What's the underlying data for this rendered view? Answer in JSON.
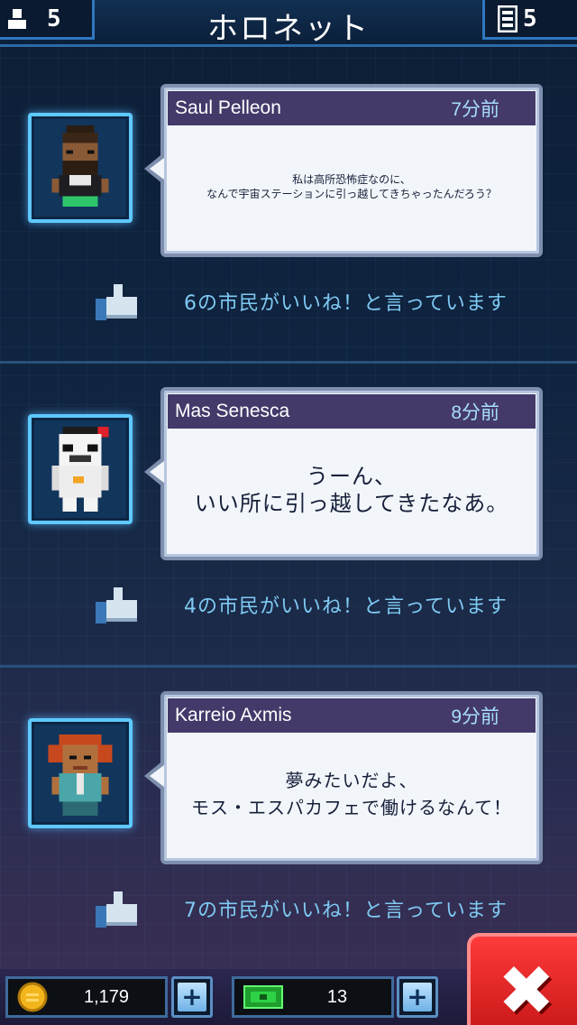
{
  "header": {
    "title": "ホロネット",
    "population": "5",
    "floors": "5"
  },
  "posts": [
    {
      "name": "Saul Pelleon",
      "time": "7分前",
      "message": "私は高所恐怖症なのに、\nなんで宇宙ステーションに引っ越してきちゃったんだろう？",
      "likes": "6の市民がいいね！と言っています"
    },
    {
      "name": "Mas Senesca",
      "time": "8分前",
      "message": "うーん、\nいい所に引っ越してきたなあ。",
      "likes": "4の市民がいいね！と言っています"
    },
    {
      "name": "Karreio Axmis",
      "time": "9分前",
      "message": "夢みたいだよ、\nモス・エスパカフェで働けるなんて！",
      "likes": "7の市民がいいね！と言っています"
    }
  ],
  "bottom": {
    "coins": "1,179",
    "bux": "13",
    "plus_label": "+",
    "close_label": "✖"
  },
  "icons": {
    "population": "person-icon",
    "floors": "floors-icon",
    "like": "thumbs-up-icon",
    "coin": "coin-icon",
    "bux": "bux-icon",
    "close": "close-icon"
  },
  "colors": {
    "accent": "#5ec8ff",
    "bubble_header": "#443a6a",
    "time_text": "#a8ddff",
    "like_text": "#7fcaf3",
    "close_button": "#e02020"
  }
}
